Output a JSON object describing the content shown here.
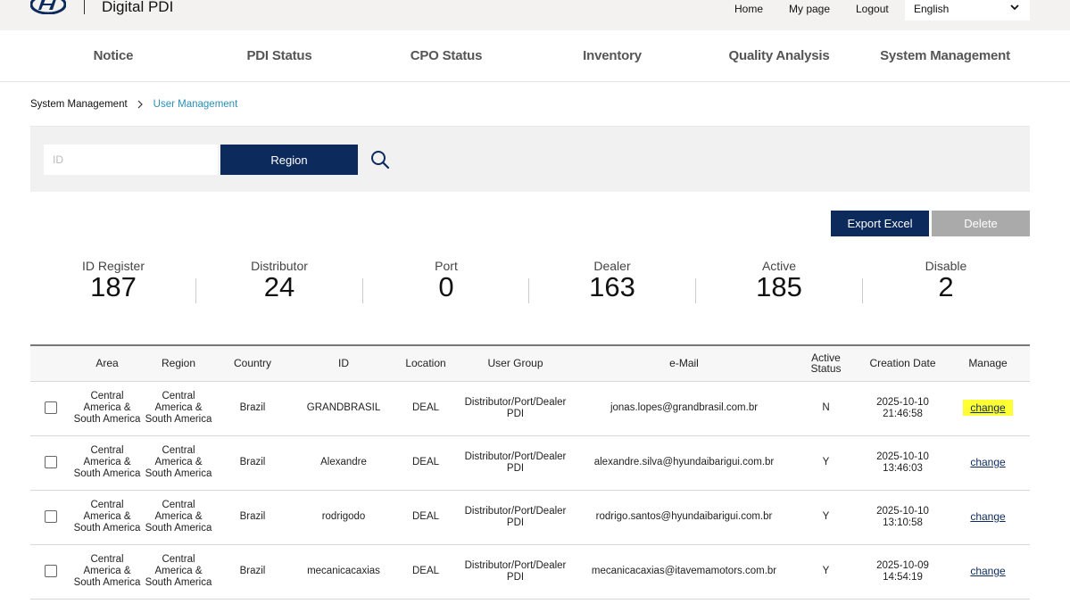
{
  "header": {
    "app_title": "Digital PDI",
    "links": {
      "home": "Home",
      "mypage": "My page",
      "logout": "Logout"
    },
    "language": "English"
  },
  "nav": {
    "items": [
      "Notice",
      "PDI Status",
      "CPO Status",
      "Inventory",
      "Quality Analysis",
      "System Management"
    ]
  },
  "breadcrumb": {
    "parent": "System Management",
    "current": "User Management"
  },
  "search": {
    "id_placeholder": "ID",
    "region_label": "Region"
  },
  "actions": {
    "export_label": "Export Excel",
    "delete_label": "Delete"
  },
  "stats": [
    {
      "label": "ID Register",
      "value": "187"
    },
    {
      "label": "Distributor",
      "value": "24"
    },
    {
      "label": "Port",
      "value": "0"
    },
    {
      "label": "Dealer",
      "value": "163"
    },
    {
      "label": "Active",
      "value": "185"
    },
    {
      "label": "Disable",
      "value": "2"
    }
  ],
  "table": {
    "headers": {
      "area": "Area",
      "region": "Region",
      "country": "Country",
      "id": "ID",
      "location": "Location",
      "user_group": "User Group",
      "email": "e-Mail",
      "active_status": "Active Status",
      "creation_date": "Creation Date",
      "manage": "Manage"
    },
    "rows": [
      {
        "area": "Central America & South America",
        "region": "Central America & South America",
        "country": "Brazil",
        "id": "GRANDBRASIL",
        "location": "DEAL",
        "user_group": "Distributor/Port/Dealer PDI",
        "email": "jonas.lopes@grandbrasil.com.br",
        "active": "N",
        "date": "2025-10-10",
        "time": "21:46:58",
        "manage": "change"
      },
      {
        "area": "Central America & South America",
        "region": "Central America & South America",
        "country": "Brazil",
        "id": "Alexandre",
        "location": "DEAL",
        "user_group": "Distributor/Port/Dealer PDI",
        "email": "alexandre.silva@hyundaibarigui.com.br",
        "active": "Y",
        "date": "2025-10-10",
        "time": "13:46:03",
        "manage": "change"
      },
      {
        "area": "Central America & South America",
        "region": "Central America & South America",
        "country": "Brazil",
        "id": "rodrigodo",
        "location": "DEAL",
        "user_group": "Distributor/Port/Dealer PDI",
        "email": "rodrigo.santos@hyundaibarigui.com.br",
        "active": "Y",
        "date": "2025-10-10",
        "time": "13:10:58",
        "manage": "change"
      },
      {
        "area": "Central America & South America",
        "region": "Central America & South America",
        "country": "Brazil",
        "id": "mecanicacaxias",
        "location": "DEAL",
        "user_group": "Distributor/Port/Dealer PDI",
        "email": "mecanicacaxias@itavemamotors.com.br",
        "active": "Y",
        "date": "2025-10-09",
        "time": "14:54:19",
        "manage": "change"
      }
    ]
  },
  "icons": {
    "logo": "hyundai-logo",
    "search": "search-icon",
    "dropdown": "chevron-down-icon",
    "breadcrumb_sep": "chevron-right-icon"
  },
  "colors": {
    "primary": "#0d2a5c",
    "link": "#2a8fb8",
    "disabled": "#aaaaaa",
    "highlight": "#ffff33"
  }
}
